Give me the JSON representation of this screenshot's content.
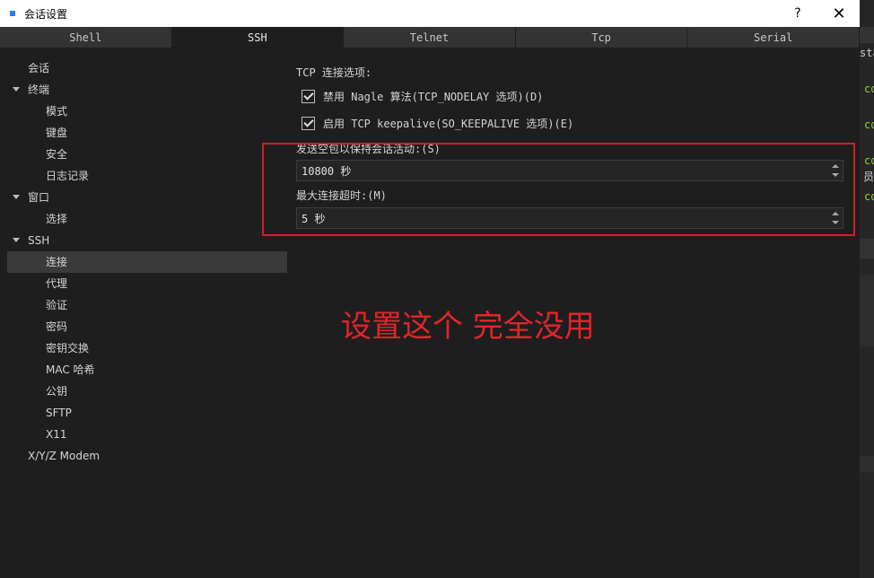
{
  "window": {
    "title": "会话设置",
    "help": "?",
    "close": "✕"
  },
  "tabs": [
    {
      "label": "Shell",
      "active": false
    },
    {
      "label": "SSH",
      "active": true
    },
    {
      "label": "Telnet",
      "active": false
    },
    {
      "label": "Tcp",
      "active": false
    },
    {
      "label": "Serial",
      "active": false
    }
  ],
  "sidebar": {
    "items": [
      {
        "label": "会话",
        "level": 0
      },
      {
        "label": "终端",
        "level": 0,
        "expanded": true
      },
      {
        "label": "模式",
        "level": 1
      },
      {
        "label": "键盘",
        "level": 1
      },
      {
        "label": "安全",
        "level": 1
      },
      {
        "label": "日志记录",
        "level": 1
      },
      {
        "label": "窗口",
        "level": 0,
        "expanded": true
      },
      {
        "label": "选择",
        "level": 1
      },
      {
        "label": "SSH",
        "level": 0,
        "expanded": true
      },
      {
        "label": "连接",
        "level": 1,
        "selected": true
      },
      {
        "label": "代理",
        "level": 1
      },
      {
        "label": "验证",
        "level": 1
      },
      {
        "label": "密码",
        "level": 1
      },
      {
        "label": "密钥交换",
        "level": 1
      },
      {
        "label": "MAC 哈希",
        "level": 1
      },
      {
        "label": "公钥",
        "level": 1
      },
      {
        "label": "SFTP",
        "level": 1
      },
      {
        "label": "X11",
        "level": 1
      },
      {
        "label": "X/Y/Z Modem",
        "level": 0
      }
    ]
  },
  "content": {
    "section_title": "TCP 连接选项:",
    "nodelay_label": "禁用 Nagle 算法(TCP_NODELAY 选项)(D)",
    "nodelay_checked": true,
    "keepalive_label": "启用 TCP keepalive(SO_KEEPALIVE 选项)(E)",
    "keepalive_checked": true,
    "keepalive_interval_label": "发送空包以保持会话活动:(S)",
    "keepalive_interval_value": "10800 秒",
    "max_timeout_label": "最大连接超时:(M)",
    "max_timeout_value": "5 秒"
  },
  "annotation": {
    "text": "设置这个 完全没用",
    "color": "#e0262b"
  },
  "background_strip": {
    "lines": [
      "sta",
      "co",
      "co",
      "co",
      "员",
      "co"
    ]
  },
  "colors": {
    "accent": "#2b7de9",
    "highlight_box": "#d01f26",
    "background": "#1e1e1e"
  }
}
